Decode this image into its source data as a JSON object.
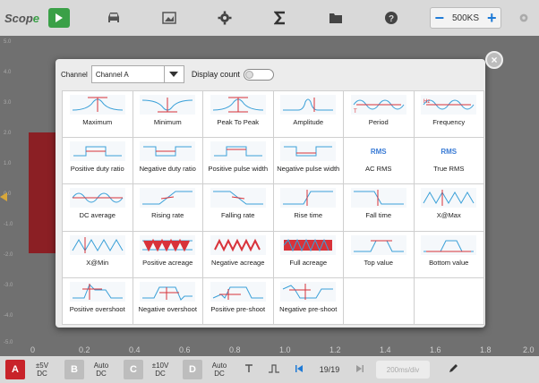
{
  "app": {
    "logo_prefix": "Scop",
    "logo_suffix": "e"
  },
  "toolbar": {
    "sample_rate": "500KS",
    "icons": [
      "play-icon",
      "car-icon",
      "image-icon",
      "gear-icon",
      "sigma-icon",
      "folder-icon",
      "help-icon",
      "settings-icon"
    ]
  },
  "plot": {
    "y_labels": [
      "5.0",
      "4.0",
      "3.0",
      "2.0",
      "1.0",
      "0.0",
      "-1.0",
      "-2.0",
      "-3.0",
      "-4.0",
      "-5.0"
    ],
    "x_labels": [
      "0",
      "0.2",
      "0.4",
      "0.6",
      "0.8",
      "1.0",
      "1.2",
      "1.4",
      "1.6",
      "1.8",
      "2.0"
    ]
  },
  "dialog": {
    "channel_label": "Channel",
    "channel_value": "Channel A",
    "display_count_label": "Display count",
    "display_count_enabled": false,
    "measurements": [
      {
        "label": "Maximum",
        "icon": "maximum-icon"
      },
      {
        "label": "Minimum",
        "icon": "minimum-icon"
      },
      {
        "label": "Peak To Peak",
        "icon": "peak-to-peak-icon"
      },
      {
        "label": "Amplitude",
        "icon": "amplitude-icon"
      },
      {
        "label": "Period",
        "icon": "period-icon"
      },
      {
        "label": "Frequency",
        "icon": "frequency-icon"
      },
      {
        "label": "Positive duty ratio",
        "icon": "positive-duty-ratio-icon"
      },
      {
        "label": "Negative duty ratio",
        "icon": "negative-duty-ratio-icon"
      },
      {
        "label": "Positive pulse width",
        "icon": "positive-pulse-width-icon"
      },
      {
        "label": "Negative pulse width",
        "icon": "negative-pulse-width-icon"
      },
      {
        "label": "AC RMS",
        "icon": "ac-rms-icon",
        "icon_text": "RMS"
      },
      {
        "label": "True RMS",
        "icon": "true-rms-icon",
        "icon_text": "RMS"
      },
      {
        "label": "DC average",
        "icon": "dc-average-icon"
      },
      {
        "label": "Rising rate",
        "icon": "rising-rate-icon"
      },
      {
        "label": "Falling rate",
        "icon": "falling-rate-icon"
      },
      {
        "label": "Rise time",
        "icon": "rise-time-icon"
      },
      {
        "label": "Fall time",
        "icon": "fall-time-icon"
      },
      {
        "label": "X@Max",
        "icon": "x-at-max-icon"
      },
      {
        "label": "X@Min",
        "icon": "x-at-min-icon"
      },
      {
        "label": "Positive acreage",
        "icon": "positive-acreage-icon"
      },
      {
        "label": "Negative acreage",
        "icon": "negative-acreage-icon"
      },
      {
        "label": "Full acreage",
        "icon": "full-acreage-icon"
      },
      {
        "label": "Top value",
        "icon": "top-value-icon"
      },
      {
        "label": "Bottom value",
        "icon": "bottom-value-icon"
      },
      {
        "label": "Positive overshoot",
        "icon": "positive-overshoot-icon"
      },
      {
        "label": "Negative overshoot",
        "icon": "negative-overshoot-icon"
      },
      {
        "label": "Positive pre-shoot",
        "icon": "positive-pre-shoot-icon"
      },
      {
        "label": "Negative pre-shoot",
        "icon": "negative-pre-shoot-icon"
      }
    ]
  },
  "bottom": {
    "ch_a": "A",
    "ch_a_volts": "±5V",
    "ch_a_coupling": "DC",
    "ch_b": "B",
    "ch_b_range": "Auto",
    "ch_b_coupling": "DC",
    "ch_c": "C",
    "ch_c_volts": "±10V",
    "ch_c_coupling": "DC",
    "ch_d": "D",
    "ch_d_range": "Auto",
    "ch_d_coupling": "DC",
    "page": "19/19",
    "timebase": "200ms/div"
  },
  "colors": {
    "accent_red": "#c8232a",
    "play_green": "#3aa047",
    "rms_blue": "#3a7bd5"
  }
}
